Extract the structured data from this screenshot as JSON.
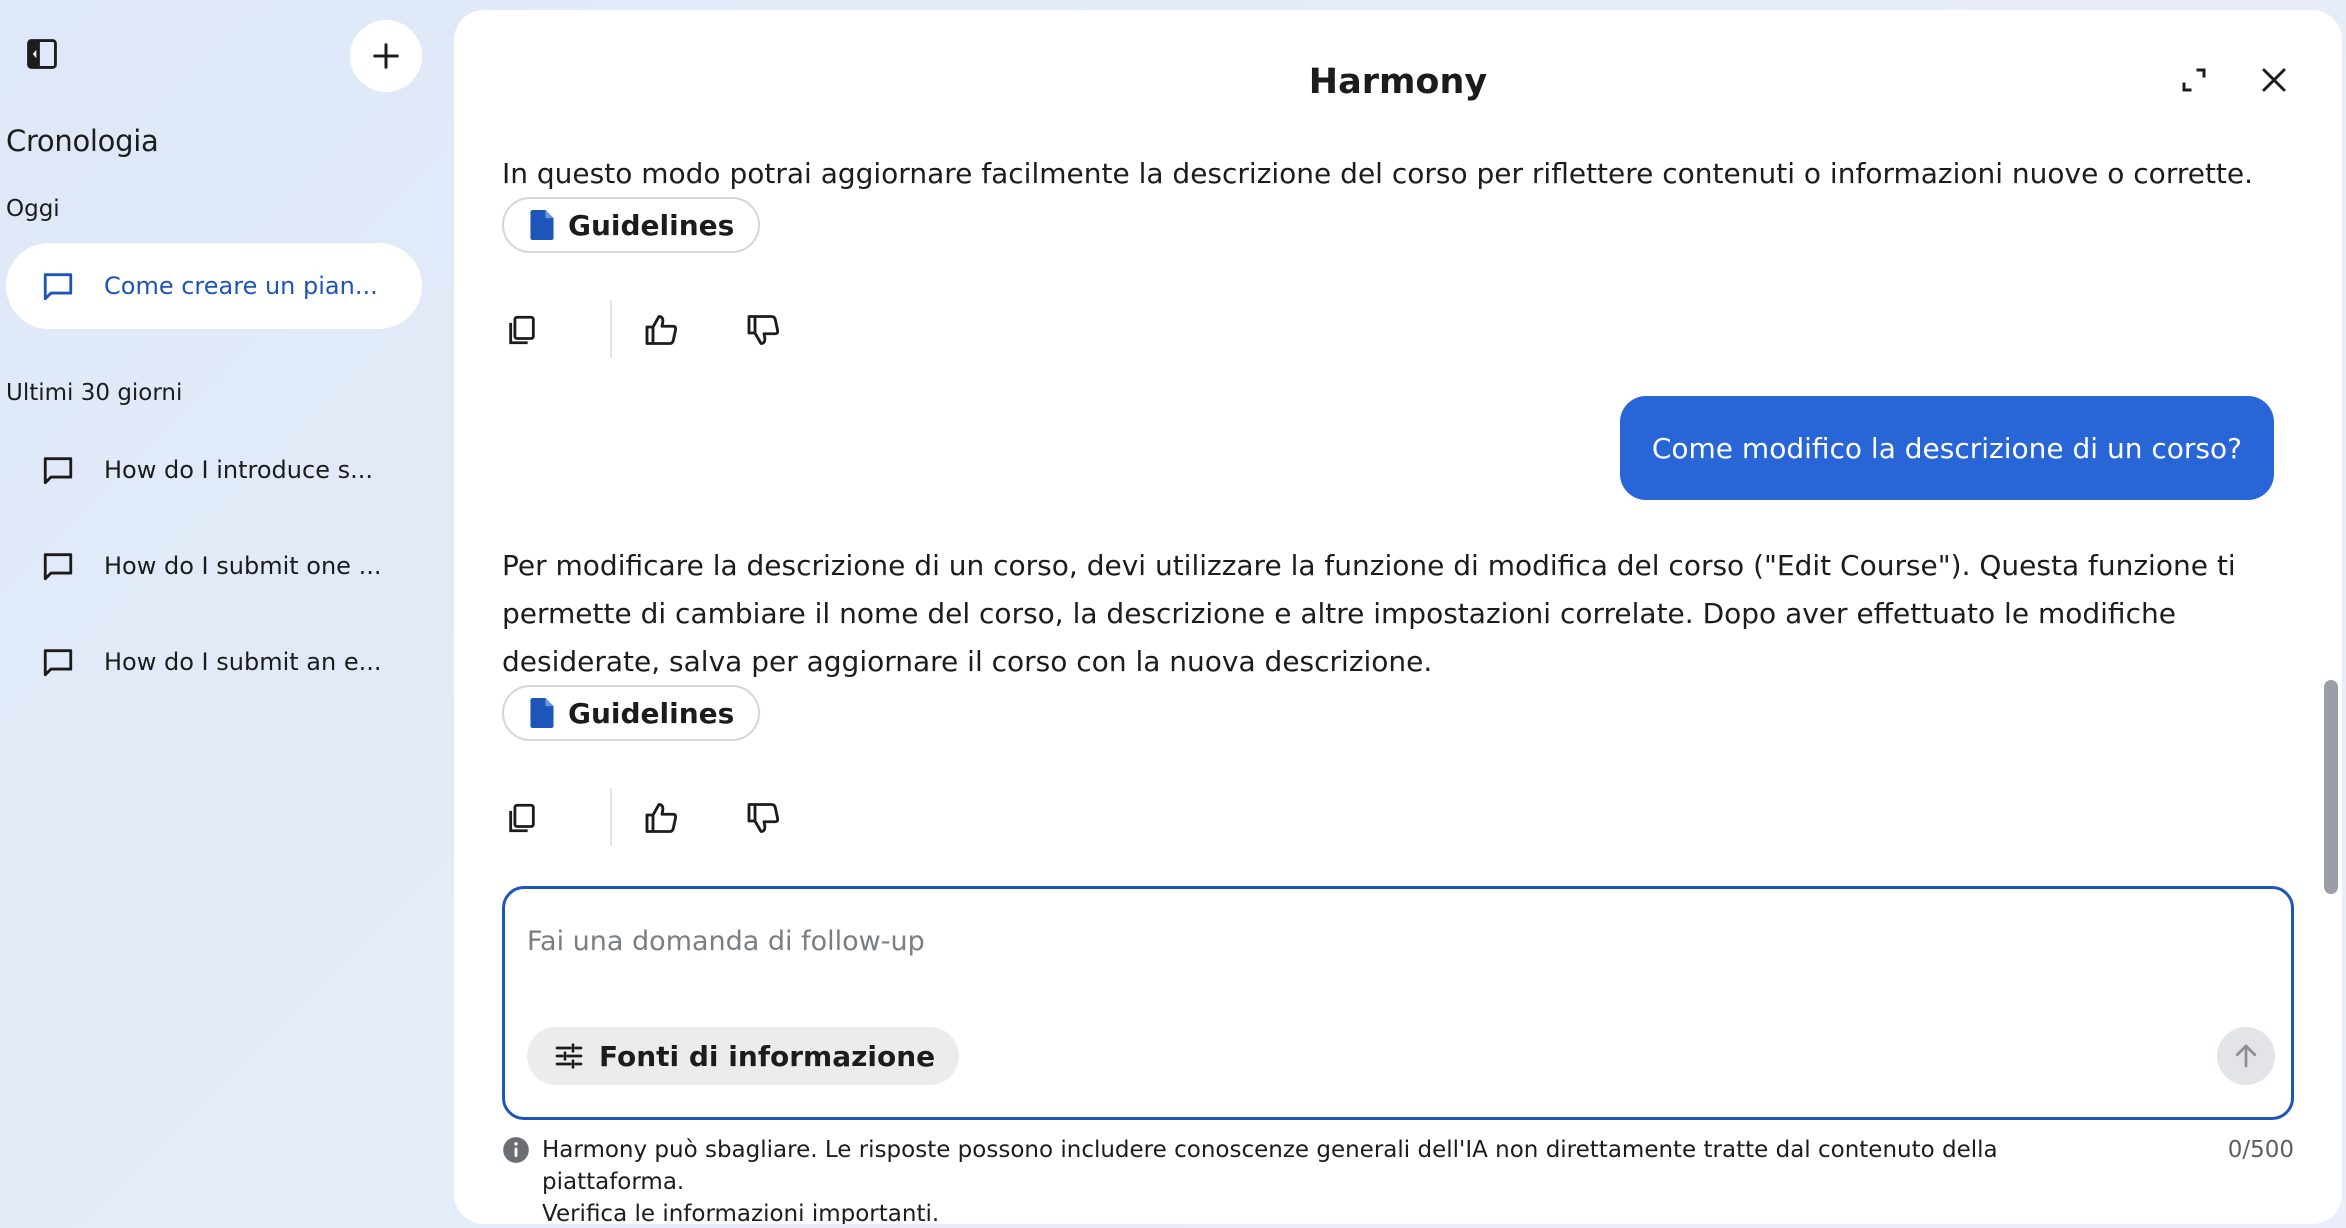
{
  "sidebar": {
    "title": "Cronologia",
    "today_label": "Oggi",
    "last30_label": "Ultimi 30 giorni",
    "today_items": [
      {
        "label": "Come creare un pian..."
      }
    ],
    "last30_items": [
      {
        "label": "How do I introduce s..."
      },
      {
        "label": "How do I submit one ..."
      },
      {
        "label": "How do I submit an e..."
      }
    ]
  },
  "panel": {
    "title": "Harmony"
  },
  "messages": {
    "assistant_1": {
      "text": "In questo modo potrai aggiornare facilmente la descrizione del corso per riflettere contenuti o informazioni nuove o corrette.",
      "source_chip": "Guidelines"
    },
    "user_1": {
      "text": "Come modifico la descrizione di un corso?"
    },
    "assistant_2": {
      "text": "Per modificare la descrizione di un corso, devi utilizzare la funzione di modifica del corso (\"Edit Course\"). Questa funzione ti permette di cambiare il nome del corso, la descrizione e altre impostazioni correlate. Dopo aver effettuato le modifiche desiderate, salva per aggiornare il corso con la nuova descrizione.",
      "source_chip": "Guidelines"
    }
  },
  "composer": {
    "placeholder": "Fai una domanda di follow-up",
    "value": "",
    "sources_label": "Fonti di informazione",
    "char_count": "0/500"
  },
  "disclaimer": {
    "line1": "Harmony può sbagliare. Le risposte possono includere conoscenze generali dell'IA non direttamente tratte dal contenuto della piattaforma.",
    "line2": "Verifica le informazioni importanti."
  },
  "colors": {
    "accent": "#2866d8",
    "accent_dark": "#1d56b8",
    "doc_icon": "#1d56b8"
  },
  "icons": {
    "sidebar_toggle": "sidebar-collapse-icon",
    "new_chat": "plus-icon",
    "chat_item": "chat-bubble-icon",
    "expand": "expand-icon",
    "close": "close-icon",
    "document": "document-icon",
    "copy": "copy-icon",
    "thumbs_up": "thumbs-up-icon",
    "thumbs_down": "thumbs-down-icon",
    "sources": "sliders-icon",
    "send": "arrow-up-icon",
    "info": "info-icon"
  }
}
